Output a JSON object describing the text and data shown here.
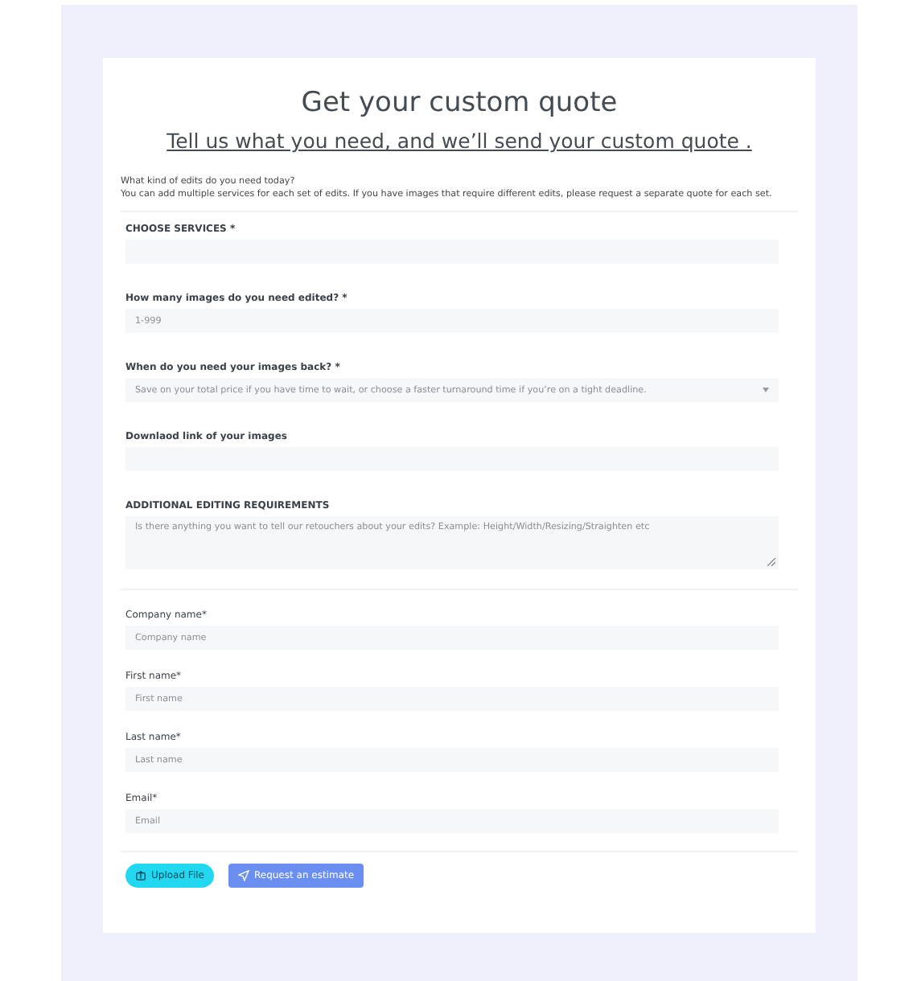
{
  "title": "Get your custom quote",
  "subtitle": "Tell us what you need, and we’ll send your custom quote .",
  "intro": [
    "What kind of edits do you need today?",
    "You can add multiple services for each set of edits. If you have images that require different edits, please request a separate quote for each set."
  ],
  "service_fields": [
    {
      "kind": "input",
      "label": "CHOOSE SERVICES *"
    },
    {
      "kind": "input",
      "label": "How many images do you need edited? *",
      "placeholder": "1-999"
    },
    {
      "kind": "select",
      "label": "When do you need your images back? *",
      "placeholder": "Save on your total price if you have time to wait, or choose a faster turnaround time if you’re on a tight deadline."
    },
    {
      "kind": "input",
      "label": "Downlaod link of your images"
    },
    {
      "kind": "textarea",
      "label": "ADDITIONAL EDITING REQUIREMENTS",
      "placeholder": "Is there anything you want to tell our retouchers about your edits? Example: Height/Width/Resizing/Straighten etc"
    }
  ],
  "contact_fields": [
    {
      "label": "Company name*",
      "placeholder": "Company name"
    },
    {
      "label": "First name*",
      "placeholder": "First name"
    },
    {
      "label": "Last name*",
      "placeholder": "Last name"
    },
    {
      "label": "Email*",
      "placeholder": "Email"
    }
  ],
  "buttons": [
    {
      "kind": "upload",
      "label": "Upload File"
    },
    {
      "kind": "submit",
      "label": "Request an estimate"
    }
  ]
}
